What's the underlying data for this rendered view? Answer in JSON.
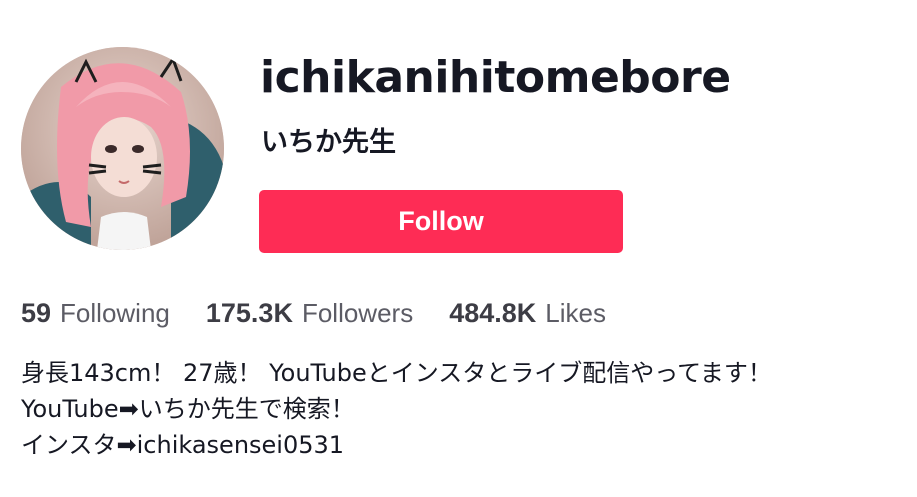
{
  "profile": {
    "username": "ichikanihitomebore",
    "nickname": "いちか先生",
    "follow_label": "Follow",
    "avatar_icon": "profile-avatar-image"
  },
  "stats": {
    "following": {
      "count": "59",
      "label": "Following"
    },
    "followers": {
      "count": "175.3K",
      "label": "Followers"
    },
    "likes": {
      "count": "484.8K",
      "label": "Likes"
    }
  },
  "bio": {
    "lines": [
      "身長143cm！ 27歳！ YouTubeとインスタとライブ配信やってます！",
      "YouTube➡いちか先生で検索！",
      "インスタ➡ichikasensei0531"
    ]
  },
  "colors": {
    "accent": "#fe2c55",
    "text": "#161823",
    "muted": "#5c5c65"
  }
}
